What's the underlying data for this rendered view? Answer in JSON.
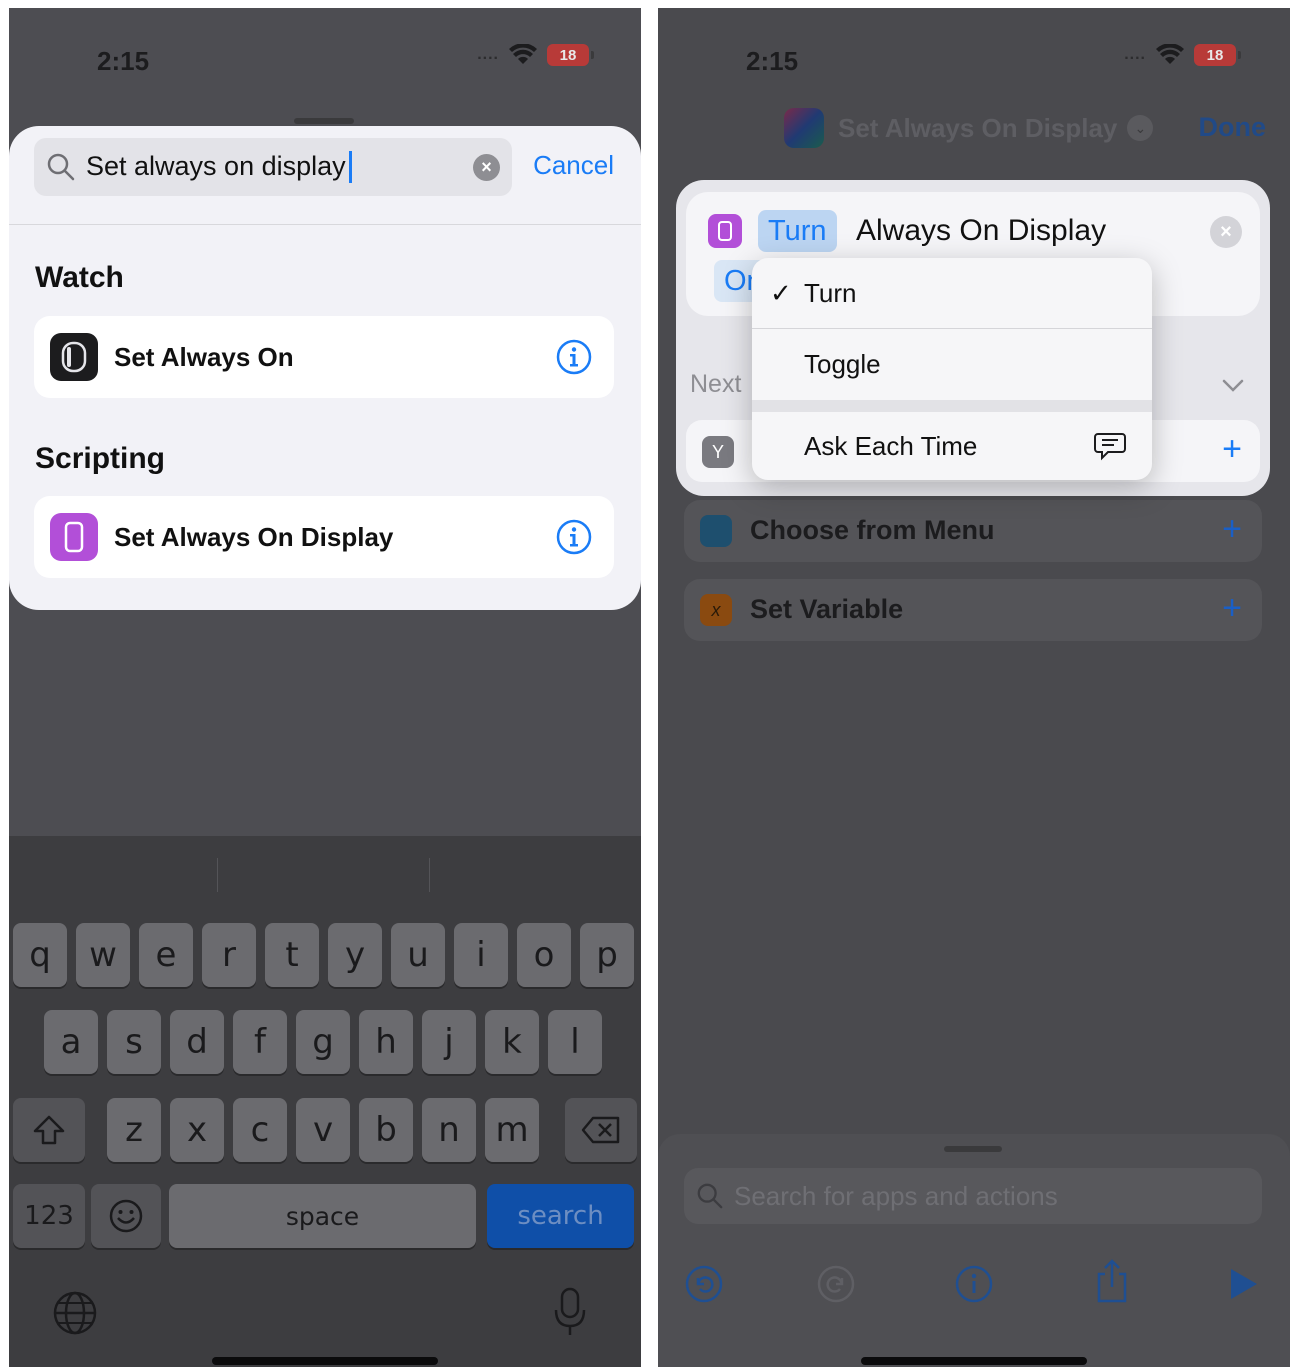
{
  "left": {
    "status": {
      "time": "2:15",
      "battery": "18"
    },
    "search": {
      "query": "Set always on display",
      "cancel_label": "Cancel"
    },
    "sections": [
      {
        "title": "Watch",
        "result": "Set Always On"
      },
      {
        "title": "Scripting",
        "result": "Set Always On Display"
      }
    ],
    "keyboard": {
      "row1": [
        "q",
        "w",
        "e",
        "r",
        "t",
        "y",
        "u",
        "i",
        "o",
        "p"
      ],
      "row2": [
        "a",
        "s",
        "d",
        "f",
        "g",
        "h",
        "j",
        "k",
        "l"
      ],
      "row3": [
        "z",
        "x",
        "c",
        "v",
        "b",
        "n",
        "m"
      ],
      "numbers_label": "123",
      "space_label": "space",
      "search_label": "search"
    }
  },
  "right": {
    "status": {
      "time": "2:15",
      "battery": "18"
    },
    "nav": {
      "title": "Set Always On Display",
      "done_label": "Done"
    },
    "action": {
      "verb": "Turn",
      "text": "Always On Display",
      "param": "On"
    },
    "next_label": "Next",
    "menu": {
      "items": [
        "Turn",
        "Toggle",
        "Ask Each Time"
      ],
      "selected": "Turn"
    },
    "suggestions": [
      "Choose from Menu",
      "Set Variable"
    ],
    "search_placeholder": "Search for apps and actions"
  },
  "colors": {
    "accent": "#1a7cf6",
    "scripting_purple": "#b24fd8",
    "watch_black": "#1c1c1e"
  }
}
